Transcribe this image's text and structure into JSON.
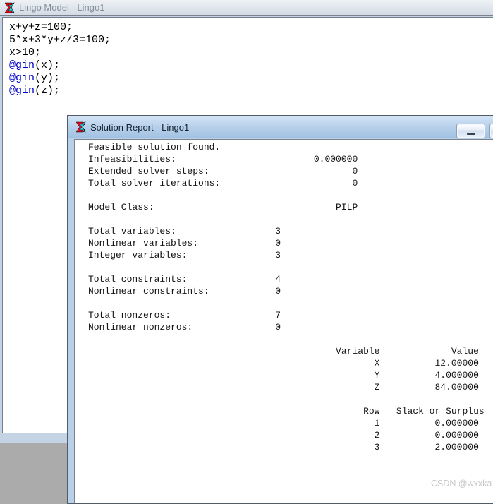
{
  "model_window": {
    "title": "Lingo Model - Lingo1",
    "icon": "lingo-logo",
    "keyword_color": "#0000cc",
    "code": [
      {
        "text": "x+y+z=100;"
      },
      {
        "text": "5*x+3*y+z/3=100;"
      },
      {
        "text": "x>10;"
      },
      {
        "keyword": "@gin",
        "text": "(x);"
      },
      {
        "keyword": "@gin",
        "text": "(y);"
      },
      {
        "keyword": "@gin",
        "text": "(z);"
      }
    ]
  },
  "report_window": {
    "title": "Solution Report - Lingo1",
    "titlebar_buttons": [
      "minimize",
      "maximize"
    ],
    "report_lines": [
      [
        [
          "Feasible solution found.",
          0
        ]
      ],
      [
        [
          "Infeasibilities:",
          0
        ],
        [
          "0.000000",
          49
        ]
      ],
      [
        [
          "Extended solver steps:",
          0
        ],
        [
          "0",
          49
        ]
      ],
      [
        [
          "Total solver iterations:",
          0
        ],
        [
          "0",
          49
        ]
      ],
      [],
      [
        [
          "Model Class:",
          0
        ],
        [
          "PILP",
          49
        ]
      ],
      [],
      [
        [
          "Total variables:",
          0
        ],
        [
          "3",
          35
        ]
      ],
      [
        [
          "Nonlinear variables:",
          0
        ],
        [
          "0",
          35
        ]
      ],
      [
        [
          "Integer variables:",
          0
        ],
        [
          "3",
          35
        ]
      ],
      [],
      [
        [
          "Total constraints:",
          0
        ],
        [
          "4",
          35
        ]
      ],
      [
        [
          "Nonlinear constraints:",
          0
        ],
        [
          "0",
          35
        ]
      ],
      [],
      [
        [
          "Total nonzeros:",
          0
        ],
        [
          "7",
          35
        ]
      ],
      [
        [
          "Nonlinear nonzeros:",
          0
        ],
        [
          "0",
          35
        ]
      ],
      [],
      [
        [
          "Variable",
          53
        ],
        [
          "Value",
          71
        ]
      ],
      [
        [
          "X",
          53
        ],
        [
          "12.00000",
          71
        ]
      ],
      [
        [
          "Y",
          53
        ],
        [
          "4.000000",
          71
        ]
      ],
      [
        [
          "Z",
          53
        ],
        [
          "84.00000",
          71
        ]
      ],
      [],
      [
        [
          "Row",
          53
        ],
        [
          "Slack or Surplus",
          72
        ]
      ],
      [
        [
          "1",
          53
        ],
        [
          "0.000000",
          71
        ]
      ],
      [
        [
          "2",
          53
        ],
        [
          "0.000000",
          71
        ]
      ],
      [
        [
          "3",
          53
        ],
        [
          "2.000000",
          71
        ]
      ]
    ]
  },
  "watermark": "CSDN @wxxka",
  "colors": {
    "mdi_background": "#ababab",
    "frame_blue": "#b9d0e9",
    "active_titlebar_top": "#d3e3f5",
    "active_titlebar_bottom": "#a2c2e2",
    "inactive_titlebar_top": "#eef2f6",
    "inactive_titlebar_bottom": "#d3dbe4",
    "keyword_blue": "#0000cc",
    "logo_red": "#e00b1e",
    "logo_cyan": "#27d3e0"
  }
}
